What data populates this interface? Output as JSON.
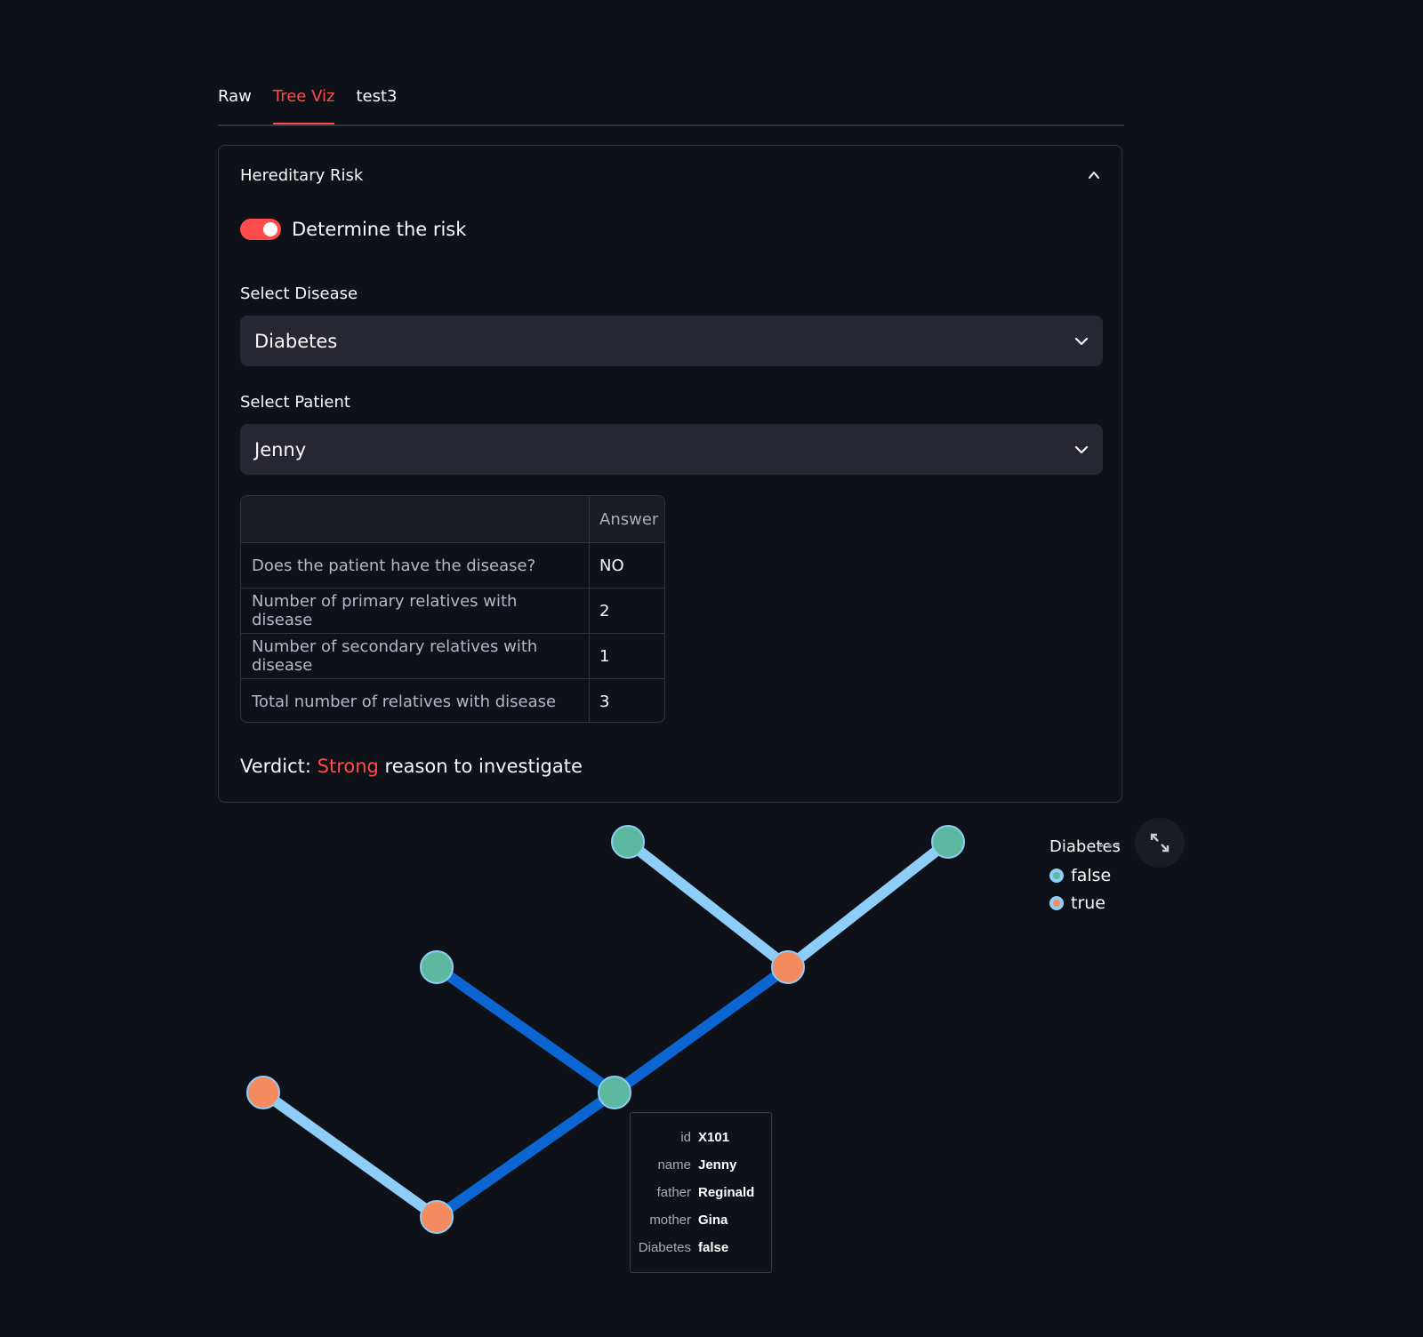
{
  "tabs": [
    {
      "label": "Raw",
      "active": false
    },
    {
      "label": "Tree Viz",
      "active": true
    },
    {
      "label": "test3",
      "active": false
    }
  ],
  "expander": {
    "title": "Hereditary Risk",
    "toggle_label": "Determine the risk",
    "toggle_on": true,
    "disease_label": "Select Disease",
    "disease_value": "Diabetes",
    "patient_label": "Select Patient",
    "patient_value": "Jenny",
    "table": {
      "header": [
        "",
        "Answer"
      ],
      "rows": [
        [
          "Does the patient have the disease?",
          "NO"
        ],
        [
          "Number of primary relatives with disease",
          "2"
        ],
        [
          "Number of secondary relatives with disease",
          "1"
        ],
        [
          "Total number of relatives with disease",
          "3"
        ]
      ]
    },
    "verdict_prefix": "Verdict: ",
    "verdict_strength": "Strong",
    "verdict_suffix": " reason to investigate"
  },
  "legend": {
    "title": "Diabetes",
    "items": [
      "false",
      "true"
    ]
  },
  "tooltip": {
    "rows": [
      {
        "key": "id",
        "value": "X101"
      },
      {
        "key": "name",
        "value": "Jenny"
      },
      {
        "key": "father",
        "value": "Reginald"
      },
      {
        "key": "mother",
        "value": "Gina"
      },
      {
        "key": "Diabetes",
        "value": "false"
      }
    ]
  },
  "colors": {
    "accent": "#ff4b4b",
    "node_false": "#5cb9a0",
    "node_true": "#f58a5e",
    "edge_light": "#8ecdf7",
    "edge_dark": "#0b66d1",
    "background": "#0e1117"
  },
  "icons": {
    "collapse": "chevron-up-icon",
    "dropdown": "chevron-down-icon",
    "fullscreen": "expand-icon",
    "menu": "more-horizontal-icon"
  }
}
